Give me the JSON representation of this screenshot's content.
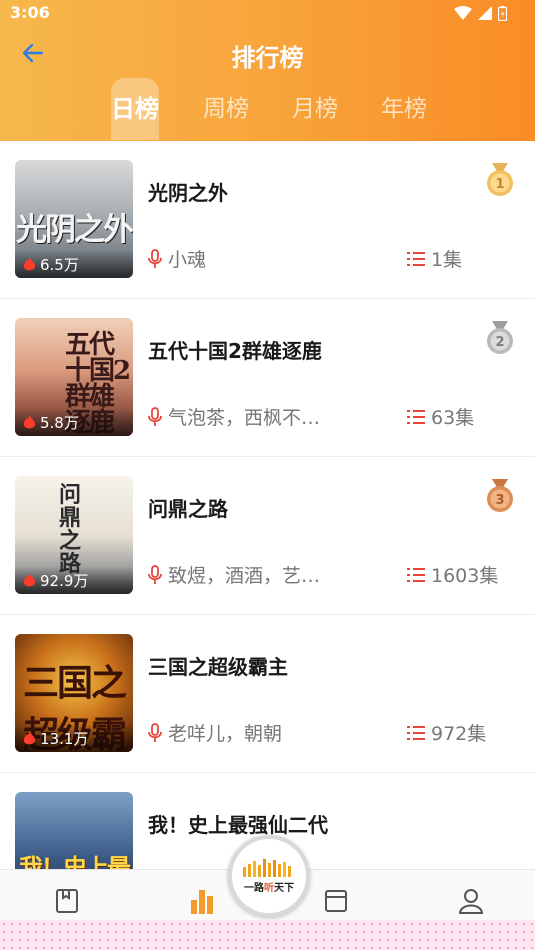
{
  "status_bar": {
    "time": "3:06"
  },
  "header": {
    "title": "排行榜",
    "tabs": [
      {
        "label": "日榜",
        "active": true
      },
      {
        "label": "周榜",
        "active": false
      },
      {
        "label": "月榜",
        "active": false
      },
      {
        "label": "年榜",
        "active": false
      }
    ]
  },
  "books": [
    {
      "rank": "1",
      "title": "光阴之外",
      "heat": "6.5万",
      "narrators": "小魂",
      "episodes": "1集"
    },
    {
      "rank": "2",
      "title": "五代十国2群雄逐鹿",
      "heat": "5.8万",
      "narrators": "气泡茶，西枫不…",
      "episodes": "63集"
    },
    {
      "rank": "3",
      "title": "问鼎之路",
      "heat": "92.9万",
      "narrators": "致煜，酒酒，艺…",
      "episodes": "1603集"
    },
    {
      "title": "三国之超级霸主",
      "heat": "13.1万",
      "narrators": "老咩儿，朝朝",
      "episodes": "972集"
    },
    {
      "title": "我！史上最强仙二代"
    }
  ],
  "bottom_nav": {
    "items": [
      {
        "label": "首页",
        "icon": "book-icon"
      },
      {
        "label": "排行",
        "icon": "ranking-bars-icon"
      },
      {
        "label": "",
        "icon": "window-icon"
      },
      {
        "label": "",
        "icon": "user-icon"
      }
    ]
  },
  "logo": {
    "part1": "一路",
    "part2": "听",
    "part3": "天下"
  },
  "colors": {
    "header_gradient_start": "#f6b84c",
    "header_gradient_end": "#fb8c26",
    "accent": "#f39a2d",
    "icon_red": "#e8453a",
    "back_arrow_blue": "#2f7be8"
  }
}
